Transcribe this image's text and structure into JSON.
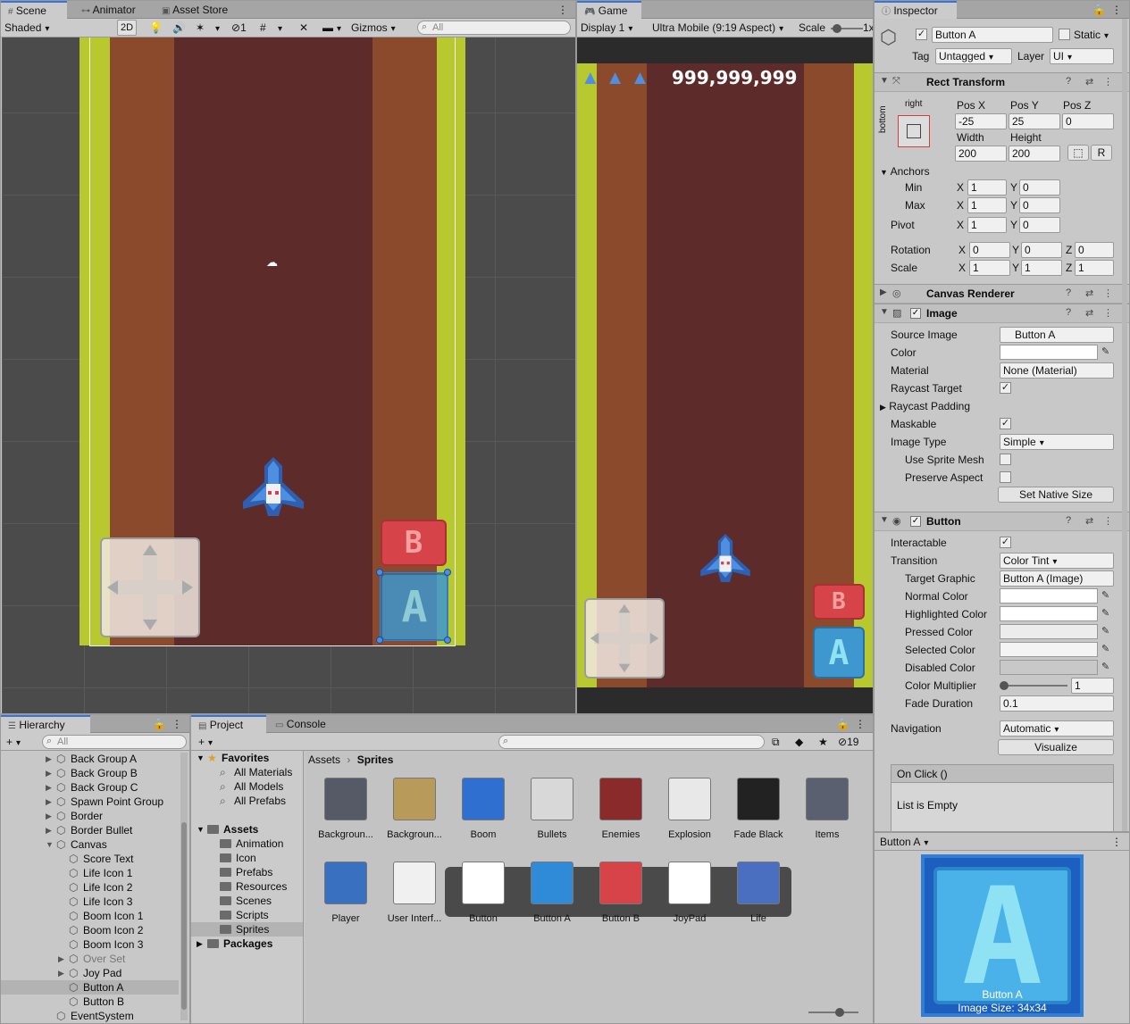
{
  "scene_panel": {
    "tabs": [
      "Scene",
      "Animator",
      "Asset Store"
    ],
    "shading": "Shaded",
    "mode_2d": "2D",
    "hidden_count": "1",
    "gizmos": "Gizmos",
    "search_placeholder": "All"
  },
  "game_panel": {
    "tab": "Game",
    "display": "Display 1",
    "aspect": "Ultra Mobile (9:19 Aspect)",
    "scale_label": "Scale",
    "scale_value": "1x",
    "score": "999,999,999",
    "button_b_letter": "B",
    "button_a_letter": "A"
  },
  "inspector": {
    "tab": "Inspector",
    "object_name": "Button A",
    "static_label": "Static",
    "tag_label": "Tag",
    "tag_value": "Untagged",
    "layer_label": "Layer",
    "layer_value": "UI",
    "rect_transform": {
      "title": "Rect Transform",
      "anchor_h": "right",
      "anchor_v": "bottom",
      "pos_x_label": "Pos X",
      "pos_x": "-25",
      "pos_y_label": "Pos Y",
      "pos_y": "25",
      "pos_z_label": "Pos Z",
      "pos_z": "0",
      "width_label": "Width",
      "width": "200",
      "height_label": "Height",
      "height": "200",
      "r_button": "R",
      "anchors_label": "Anchors",
      "min_label": "Min",
      "min_x": "1",
      "min_y": "0",
      "max_label": "Max",
      "max_x": "1",
      "max_y": "0",
      "pivot_label": "Pivot",
      "pivot_x": "1",
      "pivot_y": "0",
      "rotation_label": "Rotation",
      "rot_x": "0",
      "rot_y": "0",
      "rot_z": "0",
      "scale_label": "Scale",
      "scale_x": "1",
      "scale_y": "1",
      "scale_z": "1",
      "x": "X",
      "y": "Y",
      "z": "Z"
    },
    "canvas_renderer": {
      "title": "Canvas Renderer"
    },
    "image": {
      "title": "Image",
      "source_image_label": "Source Image",
      "source_image": "Button A",
      "color_label": "Color",
      "material_label": "Material",
      "material": "None (Material)",
      "raycast_target_label": "Raycast Target",
      "raycast_padding_label": "Raycast Padding",
      "maskable_label": "Maskable",
      "image_type_label": "Image Type",
      "image_type": "Simple",
      "use_sprite_mesh_label": "Use Sprite Mesh",
      "preserve_aspect_label": "Preserve Aspect",
      "set_native_size": "Set Native Size"
    },
    "button": {
      "title": "Button",
      "interactable_label": "Interactable",
      "transition_label": "Transition",
      "transition": "Color Tint",
      "target_graphic_label": "Target Graphic",
      "target_graphic": "Button A (Image)",
      "normal_color_label": "Normal Color",
      "highlighted_color_label": "Highlighted Color",
      "pressed_color_label": "Pressed Color",
      "selected_color_label": "Selected Color",
      "disabled_color_label": "Disabled Color",
      "color_multiplier_label": "Color Multiplier",
      "color_multiplier": "1",
      "fade_duration_label": "Fade Duration",
      "fade_duration": "0.1",
      "navigation_label": "Navigation",
      "navigation": "Automatic",
      "visualize": "Visualize",
      "on_click_label": "On Click ()",
      "list_empty": "List is Empty"
    },
    "preview": {
      "title": "Button A",
      "caption_name": "Button A",
      "caption_size": "Image Size: 34x34",
      "letter": "A"
    }
  },
  "hierarchy": {
    "tab": "Hierarchy",
    "search_placeholder": "All",
    "items": [
      {
        "label": "Back Group A",
        "depth": 1,
        "arrow": "▶"
      },
      {
        "label": "Back Group B",
        "depth": 1,
        "arrow": "▶"
      },
      {
        "label": "Back Group C",
        "depth": 1,
        "arrow": "▶"
      },
      {
        "label": "Spawn Point Group",
        "depth": 1,
        "arrow": "▶"
      },
      {
        "label": "Border",
        "depth": 1,
        "arrow": "▶"
      },
      {
        "label": "Border Bullet",
        "depth": 1,
        "arrow": "▶"
      },
      {
        "label": "Canvas",
        "depth": 1,
        "arrow": "▼"
      },
      {
        "label": "Score Text",
        "depth": 2,
        "arrow": ""
      },
      {
        "label": "Life Icon 1",
        "depth": 2,
        "arrow": ""
      },
      {
        "label": "Life Icon 2",
        "depth": 2,
        "arrow": ""
      },
      {
        "label": "Life Icon 3",
        "depth": 2,
        "arrow": ""
      },
      {
        "label": "Boom Icon 1",
        "depth": 2,
        "arrow": ""
      },
      {
        "label": "Boom Icon 2",
        "depth": 2,
        "arrow": ""
      },
      {
        "label": "Boom Icon 3",
        "depth": 2,
        "arrow": ""
      },
      {
        "label": "Over Set",
        "depth": 2,
        "arrow": "▶",
        "disabled": true
      },
      {
        "label": "Joy Pad",
        "depth": 2,
        "arrow": "▶"
      },
      {
        "label": "Button A",
        "depth": 2,
        "arrow": "",
        "selected": true
      },
      {
        "label": "Button B",
        "depth": 2,
        "arrow": ""
      },
      {
        "label": "EventSystem",
        "depth": 1,
        "arrow": ""
      }
    ]
  },
  "project": {
    "tabs": [
      "Project",
      "Console"
    ],
    "hidden_count": "19",
    "favorites_label": "Favorites",
    "favorites": [
      "All Materials",
      "All Models",
      "All Prefabs"
    ],
    "assets_label": "Assets",
    "folders": [
      "Animation",
      "Icon",
      "Prefabs",
      "Resources",
      "Scenes",
      "Scripts",
      "Sprites"
    ],
    "packages_label": "Packages",
    "breadcrumb_root": "Assets",
    "breadcrumb_current": "Sprites",
    "row1": [
      "Backgroun...",
      "Backgroun...",
      "Boom",
      "Bullets",
      "Enemies",
      "Explosion",
      "Fade Black",
      "Items"
    ],
    "row2": [
      "Player",
      "User Interf...",
      "Button",
      "Button A",
      "Button B",
      "JoyPad",
      "Life"
    ]
  }
}
